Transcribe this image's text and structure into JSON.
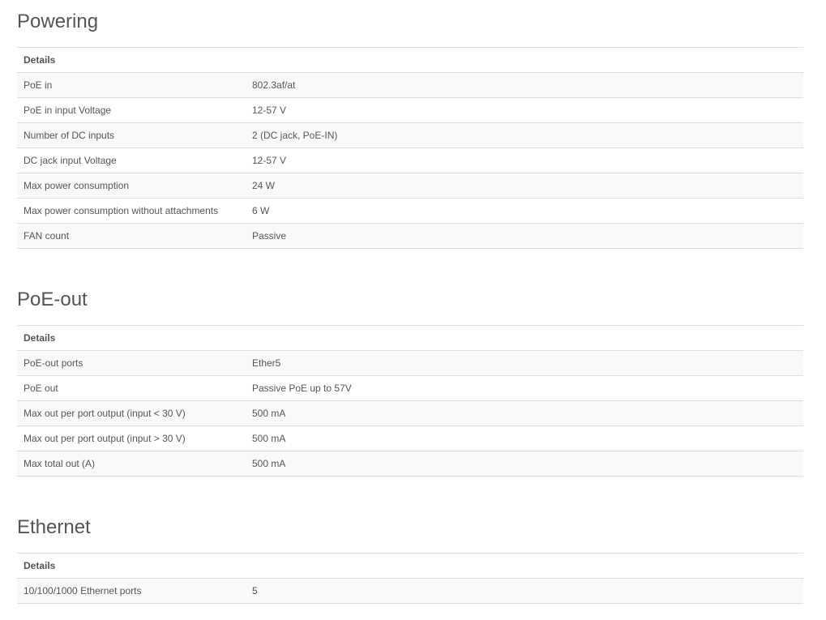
{
  "powering": {
    "title": "Powering",
    "header": "Details",
    "rows": [
      {
        "label": "PoE in",
        "value": "802.3af/at"
      },
      {
        "label": "PoE in input Voltage",
        "value": "12-57 V"
      },
      {
        "label": "Number of DC inputs",
        "value": "2 (DC jack, PoE-IN)"
      },
      {
        "label": "DC jack input Voltage",
        "value": "12-57 V"
      },
      {
        "label": "Max power consumption",
        "value": "24 W"
      },
      {
        "label": "Max power consumption without attachments",
        "value": "6 W"
      },
      {
        "label": "FAN count",
        "value": "Passive"
      }
    ]
  },
  "poe_out": {
    "title": "PoE-out",
    "header": "Details",
    "rows": [
      {
        "label": "PoE-out ports",
        "value": "Ether5"
      },
      {
        "label": "PoE out",
        "value": "Passive PoE up to 57V"
      },
      {
        "label": "Max out per port output (input < 30 V)",
        "value": "500 mA"
      },
      {
        "label": "Max out per port output (input > 30 V)",
        "value": "500 mA"
      },
      {
        "label": "Max total out (A)",
        "value": "500 mA"
      }
    ]
  },
  "ethernet": {
    "title": "Ethernet",
    "header": "Details",
    "rows": [
      {
        "label": "10/100/1000 Ethernet ports",
        "value": "5"
      }
    ]
  }
}
